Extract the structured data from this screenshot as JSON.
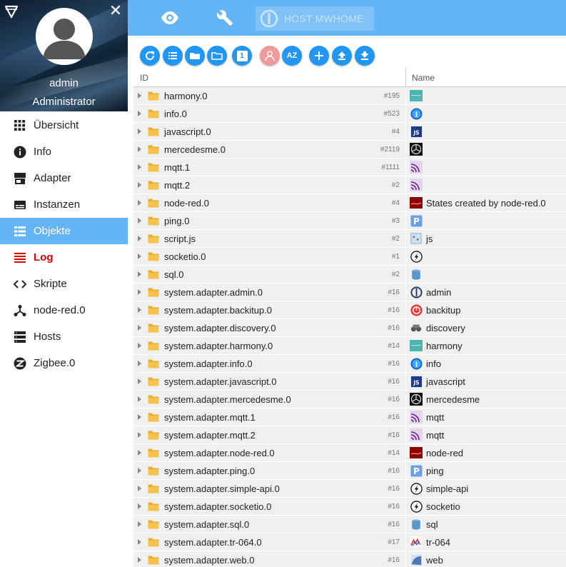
{
  "sidebar": {
    "user_name": "admin",
    "user_role": "Administrator",
    "items": [
      {
        "label": "Übersicht",
        "icon": "grid-icon",
        "state": "normal"
      },
      {
        "label": "Info",
        "icon": "info-icon",
        "state": "normal"
      },
      {
        "label": "Adapter",
        "icon": "store-icon",
        "state": "normal"
      },
      {
        "label": "Instanzen",
        "icon": "instances-icon",
        "state": "normal"
      },
      {
        "label": "Objekte",
        "icon": "list-icon",
        "state": "active"
      },
      {
        "label": "Log",
        "icon": "log-icon",
        "state": "log"
      },
      {
        "label": "Skripte",
        "icon": "code-icon",
        "state": "normal"
      },
      {
        "label": "node-red.0",
        "icon": "node-red-icon",
        "state": "normal"
      },
      {
        "label": "Hosts",
        "icon": "hosts-icon",
        "state": "normal"
      },
      {
        "label": "Zigbee.0",
        "icon": "zigbee-icon",
        "state": "normal"
      }
    ]
  },
  "topbar": {
    "host_label": "HOST MWHOME",
    "buttons": [
      "eye-icon",
      "wrench-icon"
    ]
  },
  "toolbar": {
    "buttons": [
      "refresh-icon",
      "list-view-icon",
      "folder-open-icon",
      "folder-icon",
      "counter-icon",
      "expert-mode-icon",
      "sort-az-icon",
      "add-icon",
      "upload-icon",
      "download-icon"
    ],
    "counter_label": "1"
  },
  "table": {
    "columns": {
      "id": "ID",
      "name": "Name"
    },
    "rows": [
      {
        "id": "harmony.0",
        "count": "#195",
        "name": "",
        "icon": "harmony"
      },
      {
        "id": "info.0",
        "count": "#523",
        "name": "",
        "icon": "info"
      },
      {
        "id": "javascript.0",
        "count": "#4",
        "name": "",
        "icon": "javascript"
      },
      {
        "id": "mercedesme.0",
        "count": "#2119",
        "name": "",
        "icon": "mercedes"
      },
      {
        "id": "mqtt.1",
        "count": "#1111",
        "name": "",
        "icon": "mqtt"
      },
      {
        "id": "mqtt.2",
        "count": "#2",
        "name": "",
        "icon": "mqtt"
      },
      {
        "id": "node-red.0",
        "count": "#4",
        "name": "States created by node-red.0",
        "icon": "nodered"
      },
      {
        "id": "ping.0",
        "count": "#3",
        "name": "",
        "icon": "ping"
      },
      {
        "id": "script.js",
        "count": "#2",
        "name": "js",
        "icon": "script"
      },
      {
        "id": "socketio.0",
        "count": "#1",
        "name": "",
        "icon": "socketio"
      },
      {
        "id": "sql.0",
        "count": "#2",
        "name": "",
        "icon": "sql"
      },
      {
        "id": "system.adapter.admin.0",
        "count": "#16",
        "name": "admin",
        "icon": "admin"
      },
      {
        "id": "system.adapter.backitup.0",
        "count": "#16",
        "name": "backitup",
        "icon": "backitup"
      },
      {
        "id": "system.adapter.discovery.0",
        "count": "#16",
        "name": "discovery",
        "icon": "discovery"
      },
      {
        "id": "system.adapter.harmony.0",
        "count": "#14",
        "name": "harmony",
        "icon": "harmony"
      },
      {
        "id": "system.adapter.info.0",
        "count": "#16",
        "name": "info",
        "icon": "info"
      },
      {
        "id": "system.adapter.javascript.0",
        "count": "#16",
        "name": "javascript",
        "icon": "javascript"
      },
      {
        "id": "system.adapter.mercedesme.0",
        "count": "#16",
        "name": "mercedesme",
        "icon": "mercedes"
      },
      {
        "id": "system.adapter.mqtt.1",
        "count": "#16",
        "name": "mqtt",
        "icon": "mqtt"
      },
      {
        "id": "system.adapter.mqtt.2",
        "count": "#16",
        "name": "mqtt",
        "icon": "mqtt"
      },
      {
        "id": "system.adapter.node-red.0",
        "count": "#14",
        "name": "node-red",
        "icon": "nodered"
      },
      {
        "id": "system.adapter.ping.0",
        "count": "#16",
        "name": "ping",
        "icon": "ping"
      },
      {
        "id": "system.adapter.simple-api.0",
        "count": "#16",
        "name": "simple-api",
        "icon": "socketio"
      },
      {
        "id": "system.adapter.socketio.0",
        "count": "#16",
        "name": "socketio",
        "icon": "socketio"
      },
      {
        "id": "system.adapter.sql.0",
        "count": "#16",
        "name": "sql",
        "icon": "sql"
      },
      {
        "id": "system.adapter.tr-064.0",
        "count": "#17",
        "name": "tr-064",
        "icon": "tr064"
      },
      {
        "id": "system.adapter.web.0",
        "count": "#16",
        "name": "web",
        "icon": "web"
      }
    ]
  },
  "colors": {
    "accent": "#64b5f6",
    "button": "#2196f3",
    "log": "#d50000",
    "row_bg": "#f0f0f0",
    "folder": "#f5c24c"
  }
}
